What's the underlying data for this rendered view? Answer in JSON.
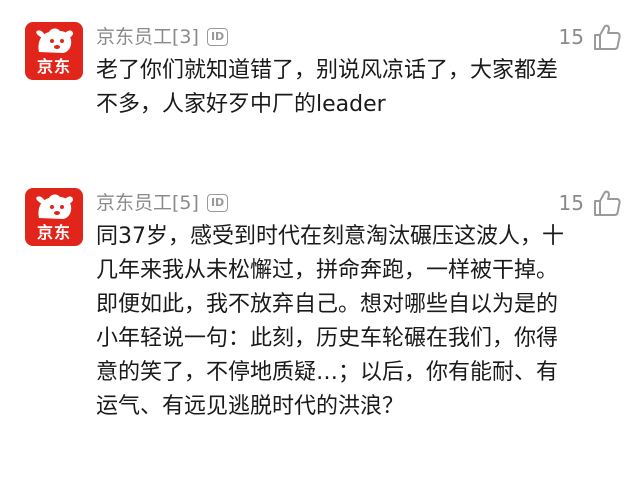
{
  "comments": [
    {
      "avatar_label": "京东",
      "username": "京东员工",
      "level": "[3]",
      "id_badge": "ID",
      "likes": "15",
      "text": "老了你们就知道错了，别说风凉话了，大家都差不多，人家好歹中厂的leader",
      "icons": {
        "avatar": "jd-dog-logo-icon",
        "like": "thumbs-up-icon",
        "badge": "id-badge-icon"
      }
    },
    {
      "avatar_label": "京东",
      "username": "京东员工",
      "level": "[5]",
      "id_badge": "ID",
      "likes": "15",
      "text": "同37岁，感受到时代在刻意淘汰碾压这波人，十几年来我从未松懈过，拼命奔跑，一样被干掉。即便如此，我不放弃自己。想对哪些自以为是的小年轻说一句：此刻，历史车轮碾在我们，你得意的笑了，不停地质疑…；以后，你有能耐、有运气、有远见逃脱时代的洪浪？",
      "icons": {
        "avatar": "jd-dog-logo-icon",
        "like": "thumbs-up-icon",
        "badge": "id-badge-icon"
      }
    }
  ],
  "colors": {
    "brand_red": "#e1251b",
    "meta_gray": "#8a8a8a",
    "text": "#1a1a1a"
  }
}
